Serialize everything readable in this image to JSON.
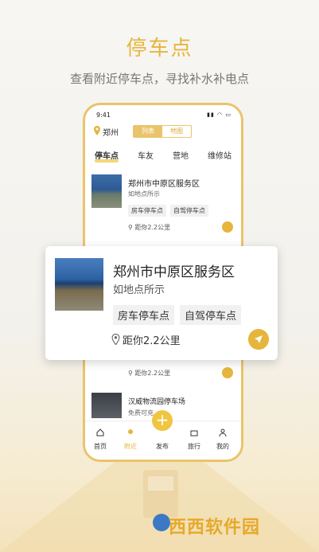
{
  "header": {
    "title": "停车点",
    "subtitle": "查看附近停车点，寻找补水补电点"
  },
  "phone": {
    "status_time": "9:41",
    "city": "郑州",
    "view_toggle": [
      "列表",
      "地图"
    ],
    "tabs": [
      "停车点",
      "车友",
      "营地",
      "维修站"
    ],
    "list": [
      {
        "name": "郑州市中原区服务区",
        "subtitle": "如地点所示",
        "tags": [
          "房车停车点",
          "自驾停车点"
        ],
        "distance": "距你2.2公里"
      },
      {
        "distance": "距你2.2公里"
      },
      {
        "name": "汉威物流园停车场",
        "subtitle": "免费可充..."
      }
    ],
    "bottom_nav": [
      "首页",
      "附近",
      "发布",
      "旅行",
      "我的"
    ],
    "fab": "+"
  },
  "popup_card": {
    "name": "郑州市中原区服务区",
    "subtitle": "如地点所示",
    "tags": [
      "房车停车点",
      "自驾停车点"
    ],
    "distance": "距你2.2公里"
  },
  "watermark": {
    "brand": "西西软件园"
  },
  "colors": {
    "accent": "#e8b53b",
    "fab": "#f0c53f"
  }
}
